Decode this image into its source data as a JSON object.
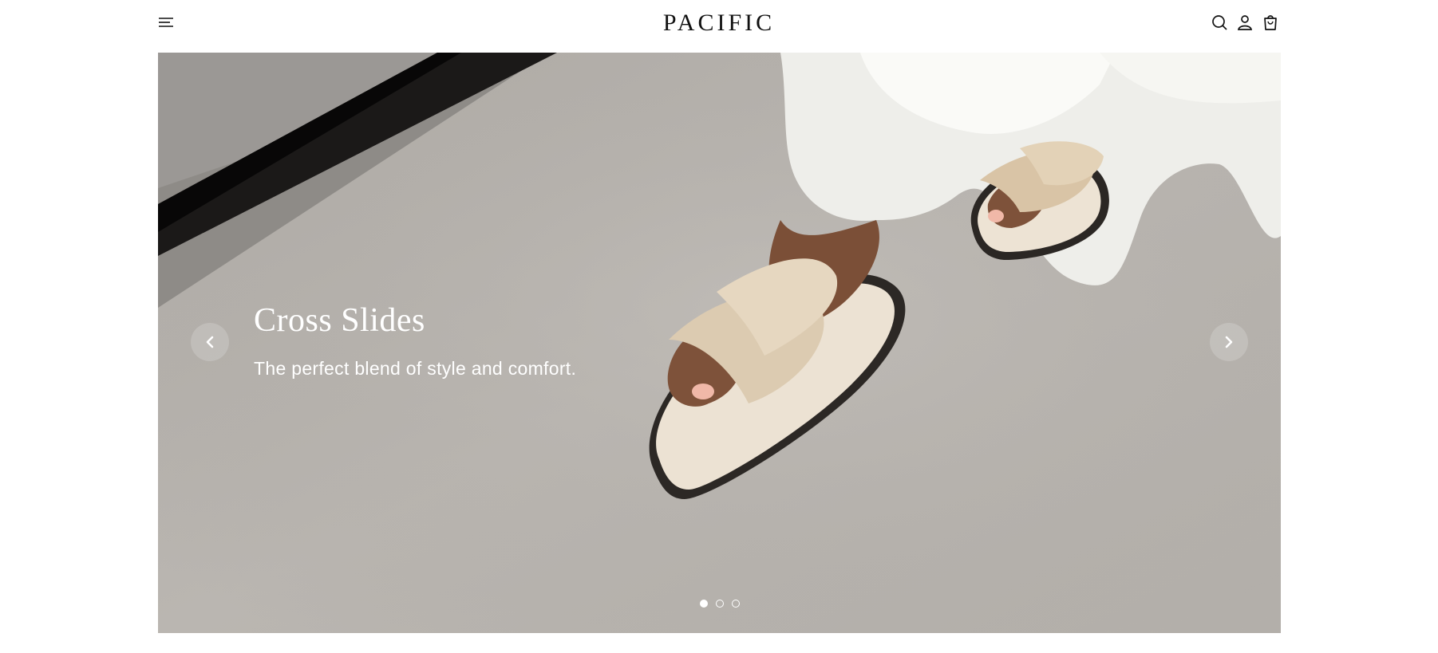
{
  "header": {
    "logo": "PACIFIC",
    "icons": [
      "menu-icon",
      "search-icon",
      "account-icon",
      "cart-icon"
    ]
  },
  "hero": {
    "title": "Cross Slides",
    "subtitle": "The perfect blend of style and comfort.",
    "slide_count": 3,
    "active_slide": 1
  },
  "colors": {
    "text": "#111111",
    "hero_text": "#ffffff",
    "floor": "#b7b3ae"
  }
}
